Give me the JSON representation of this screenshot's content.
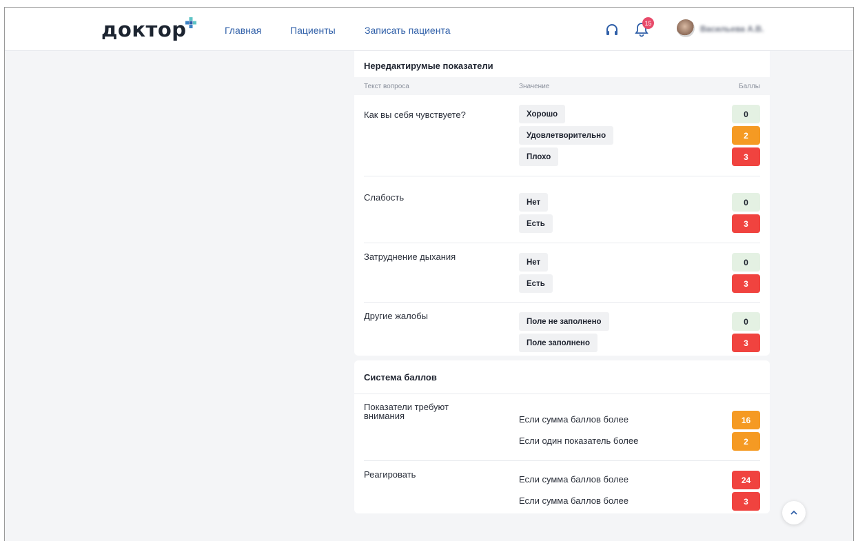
{
  "header": {
    "logo_text": "доктор",
    "nav": [
      {
        "label": "Главная"
      },
      {
        "label": "Пациенты"
      },
      {
        "label": "Записать пациента"
      }
    ],
    "notifications_count": "15",
    "user_name": "Васильева А.В."
  },
  "indicators": {
    "title": "Нередактирумые показатели",
    "columns": {
      "question": "Текст вопроса",
      "value": "Значение",
      "score": "Баллы"
    },
    "questions": [
      {
        "text": "Как вы себя чувствуете?",
        "options": [
          {
            "label": "Хорошо",
            "score": "0",
            "level": "green"
          },
          {
            "label": "Удовлетворительно",
            "score": "2",
            "level": "orange"
          },
          {
            "label": "Плохо",
            "score": "3",
            "level": "red"
          }
        ]
      },
      {
        "text": "Слабость",
        "options": [
          {
            "label": "Нет",
            "score": "0",
            "level": "green"
          },
          {
            "label": "Есть",
            "score": "3",
            "level": "red"
          }
        ]
      },
      {
        "text": "Затруднение дыхания",
        "options": [
          {
            "label": "Нет",
            "score": "0",
            "level": "green"
          },
          {
            "label": "Есть",
            "score": "3",
            "level": "red"
          }
        ]
      },
      {
        "text": "Другие жалобы",
        "options": [
          {
            "label": "Поле не заполнено",
            "score": "0",
            "level": "green"
          },
          {
            "label": "Поле заполнено",
            "score": "3",
            "level": "red"
          }
        ]
      }
    ]
  },
  "scoring": {
    "title": "Система баллов",
    "groups": [
      {
        "label_line1": "Показатели требуют",
        "label_line2": "внимания",
        "rules": [
          {
            "text": "Если сумма баллов более",
            "value": "16",
            "level": "orange"
          },
          {
            "text": "Если один показатель более",
            "value": "2",
            "level": "orange"
          }
        ]
      },
      {
        "label_line1": "Реагировать",
        "label_line2": "",
        "rules": [
          {
            "text": "Если сумма баллов более",
            "value": "24",
            "level": "red"
          },
          {
            "text": "Если сумма баллов более",
            "value": "3",
            "level": "red"
          }
        ]
      }
    ]
  },
  "colors": {
    "accent": "#2f5fa8",
    "green_bg": "#e4f1e3",
    "orange": "#f59a23",
    "red": "#f0433f",
    "badge": "#e84a6a"
  },
  "icons": [
    "medical-cross-icon",
    "headset-icon",
    "bell-icon",
    "chevron-up-icon"
  ]
}
